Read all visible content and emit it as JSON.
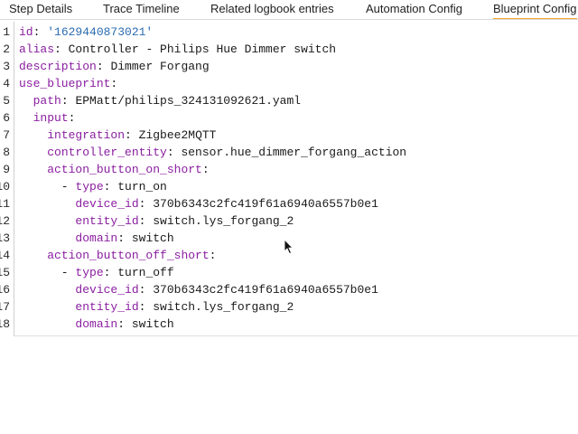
{
  "tabs": [
    {
      "label": "Step Details",
      "active": false
    },
    {
      "label": "Trace Timeline",
      "active": false
    },
    {
      "label": "Related logbook entries",
      "active": false
    },
    {
      "label": "Automation Config",
      "active": false
    },
    {
      "label": "Blueprint Config",
      "active": true
    }
  ],
  "colors": {
    "accent_tab_underline": "#f4a32a",
    "yaml_key": "#8a1ea0",
    "yaml_string": "#2a6bb0"
  },
  "editor": {
    "line_numbers": [
      "1",
      "2",
      "3",
      "4",
      "5",
      "6",
      "7",
      "8",
      "9",
      "10",
      "11",
      "12",
      "13",
      "14",
      "15",
      "16",
      "17",
      "18"
    ],
    "lines": [
      {
        "indent": "",
        "key": "id",
        "sep": ": ",
        "value": "'1629440873021'",
        "value_type": "string"
      },
      {
        "indent": "",
        "key": "alias",
        "sep": ": ",
        "value": "Controller - Philips Hue Dimmer switch",
        "value_type": "plain"
      },
      {
        "indent": "",
        "key": "description",
        "sep": ": ",
        "value": "Dimmer Forgang",
        "value_type": "plain"
      },
      {
        "indent": "",
        "key": "use_blueprint",
        "sep": ":",
        "value": "",
        "value_type": "plain"
      },
      {
        "indent": "  ",
        "key": "path",
        "sep": ": ",
        "value": "EPMatt/philips_324131092621.yaml",
        "value_type": "plain"
      },
      {
        "indent": "  ",
        "key": "input",
        "sep": ":",
        "value": "",
        "value_type": "plain"
      },
      {
        "indent": "    ",
        "key": "integration",
        "sep": ": ",
        "value": "Zigbee2MQTT",
        "value_type": "plain"
      },
      {
        "indent": "    ",
        "key": "controller_entity",
        "sep": ": ",
        "value": "sensor.hue_dimmer_forgang_action",
        "value_type": "plain"
      },
      {
        "indent": "    ",
        "key": "action_button_on_short",
        "sep": ":",
        "value": "",
        "value_type": "plain"
      },
      {
        "indent": "      - ",
        "key": "type",
        "sep": ": ",
        "value": "turn_on",
        "value_type": "plain"
      },
      {
        "indent": "        ",
        "key": "device_id",
        "sep": ": ",
        "value": "370b6343c2fc419f61a6940a6557b0e1",
        "value_type": "plain"
      },
      {
        "indent": "        ",
        "key": "entity_id",
        "sep": ": ",
        "value": "switch.lys_forgang_2",
        "value_type": "plain"
      },
      {
        "indent": "        ",
        "key": "domain",
        "sep": ": ",
        "value": "switch",
        "value_type": "plain"
      },
      {
        "indent": "    ",
        "key": "action_button_off_short",
        "sep": ":",
        "value": "",
        "value_type": "plain"
      },
      {
        "indent": "      - ",
        "key": "type",
        "sep": ": ",
        "value": "turn_off",
        "value_type": "plain"
      },
      {
        "indent": "        ",
        "key": "device_id",
        "sep": ": ",
        "value": "370b6343c2fc419f61a6940a6557b0e1",
        "value_type": "plain"
      },
      {
        "indent": "        ",
        "key": "entity_id",
        "sep": ": ",
        "value": "switch.lys_forgang_2",
        "value_type": "plain"
      },
      {
        "indent": "        ",
        "key": "domain",
        "sep": ": ",
        "value": "switch",
        "value_type": "plain"
      }
    ]
  },
  "cursor_icon": "mouse-pointer-icon"
}
